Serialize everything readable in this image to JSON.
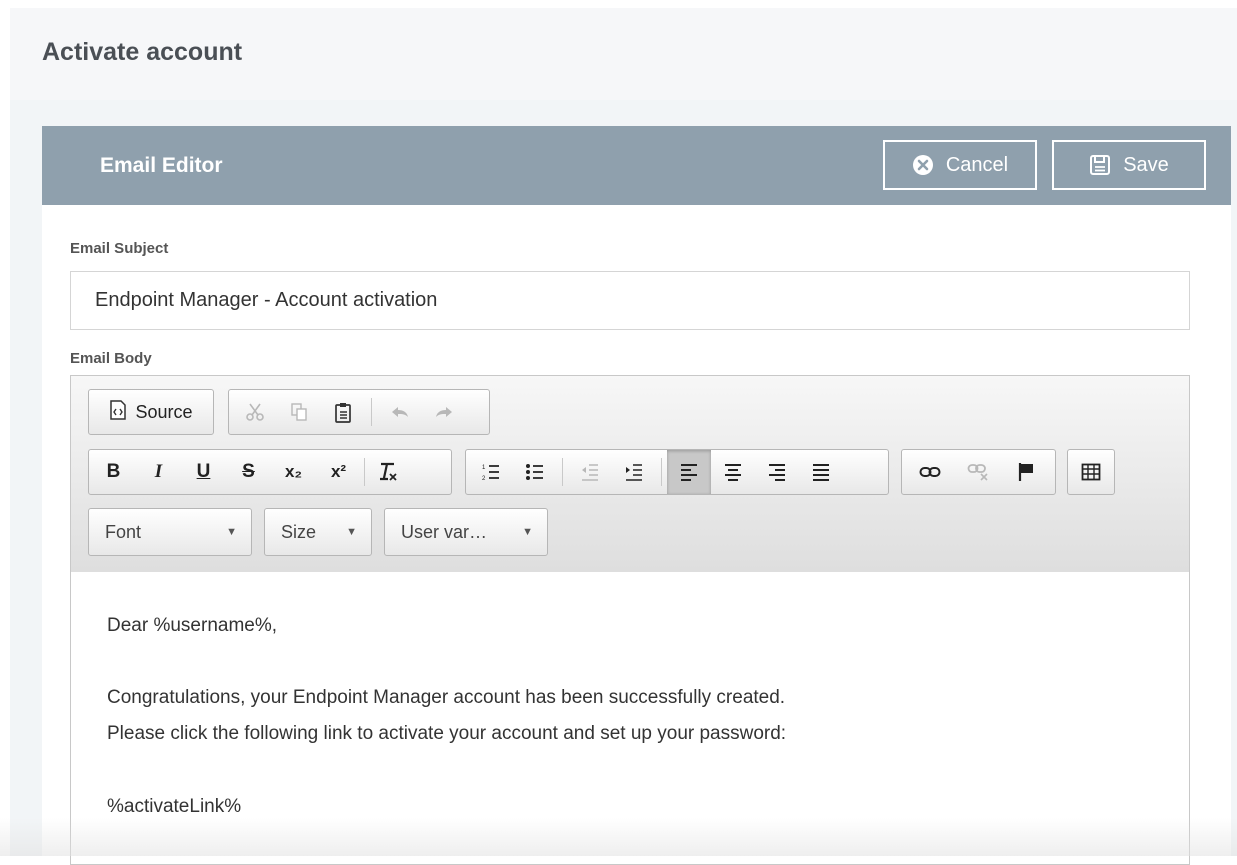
{
  "page": {
    "title": "Activate account"
  },
  "editor_card": {
    "title": "Email Editor",
    "cancel_label": "Cancel",
    "save_label": "Save"
  },
  "subject": {
    "label": "Email Subject",
    "value": "Endpoint Manager - Account activation"
  },
  "body": {
    "label": "Email Body",
    "lines": [
      "Dear %username%,",
      "Congratulations, your Endpoint Manager account has been successfully created.",
      "Please click the following link to activate your account and set up your password:",
      "%activateLink%"
    ]
  },
  "toolbar": {
    "source_label": "Source",
    "font_combo": "Font",
    "size_combo": "Size",
    "uservar_combo": "User var…",
    "bold": "B",
    "italic": "I",
    "underline": "U",
    "strike": "S",
    "subscript": "x₂",
    "superscript": "x²",
    "active_alignment": "align-left"
  },
  "colors": {
    "header_bar": "#8fa0ad",
    "page_background": "#f2f5f7",
    "title_text": "#4a4f55"
  }
}
